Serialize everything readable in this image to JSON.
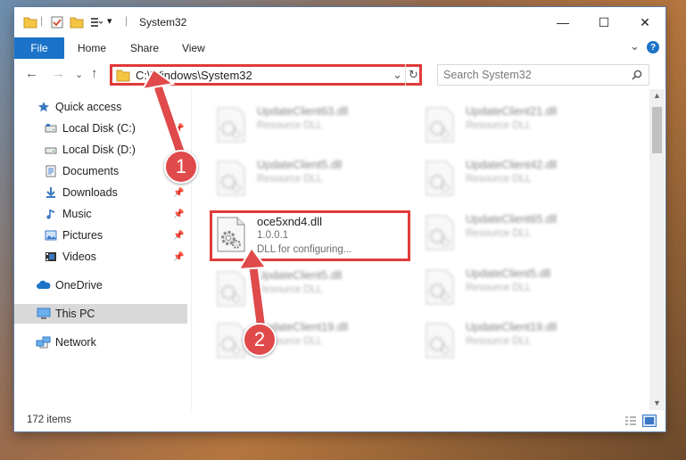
{
  "window": {
    "title": "System32",
    "minimize": "—",
    "maximize": "☐",
    "close": "✕"
  },
  "ribbon": {
    "file": "File",
    "tabs": [
      "Home",
      "Share",
      "View"
    ],
    "expand": "⌄",
    "help": "?"
  },
  "address": {
    "path": "C:\\Windows\\System32",
    "dropdown": "⌄",
    "refresh": "↻",
    "search_placeholder": "Search System32"
  },
  "nav": {
    "back": "←",
    "forward": "→",
    "recent": "⌄",
    "up": "↑"
  },
  "sidebar": {
    "items": [
      {
        "label": "Quick access",
        "icon": "star-icon",
        "pinned": false
      },
      {
        "label": "Local Disk (C:)",
        "icon": "drive-icon",
        "pinned": true
      },
      {
        "label": "Local Disk (D:)",
        "icon": "drive-icon",
        "pinned": true
      },
      {
        "label": "Documents",
        "icon": "documents-icon",
        "pinned": true
      },
      {
        "label": "Downloads",
        "icon": "downloads-icon",
        "pinned": true
      },
      {
        "label": "Music",
        "icon": "music-icon",
        "pinned": true
      },
      {
        "label": "Pictures",
        "icon": "pictures-icon",
        "pinned": true
      },
      {
        "label": "Videos",
        "icon": "videos-icon",
        "pinned": true
      },
      {
        "label": "OneDrive",
        "icon": "cloud-icon",
        "pinned": false
      },
      {
        "label": "This PC",
        "icon": "computer-icon",
        "pinned": false
      },
      {
        "label": "Network",
        "icon": "network-icon",
        "pinned": false
      }
    ]
  },
  "files": {
    "left": [
      {
        "name": "UpdateClient63.dll",
        "sub": "Resource DLL"
      },
      {
        "name": "UpdateClient5.dll",
        "sub": "Resource DLL"
      },
      {
        "name": "oce5xnd4.dll",
        "version": "1.0.0.1",
        "desc": "DLL for configuring..."
      },
      {
        "name": "UpdateClient5.dll",
        "sub": "Resource DLL"
      },
      {
        "name": "UpdateClient19.dll",
        "sub": "Resource DLL"
      }
    ],
    "right": [
      {
        "name": "UpdateClient21.dll",
        "sub": "Resource DLL"
      },
      {
        "name": "UpdateClient42.dll",
        "sub": "Resource DLL"
      },
      {
        "name": "UpdateClient65.dll",
        "sub": "Resource DLL"
      },
      {
        "name": "UpdateClient5.dll",
        "sub": "Resource DLL"
      },
      {
        "name": "UpdateClient19.dll",
        "sub": "Resource DLL"
      }
    ]
  },
  "status": {
    "count": "172 items"
  },
  "callouts": [
    "1",
    "2"
  ],
  "colors": {
    "accent": "#1a73c8",
    "highlight": "#e03a3a",
    "callout": "#e04a4a"
  }
}
